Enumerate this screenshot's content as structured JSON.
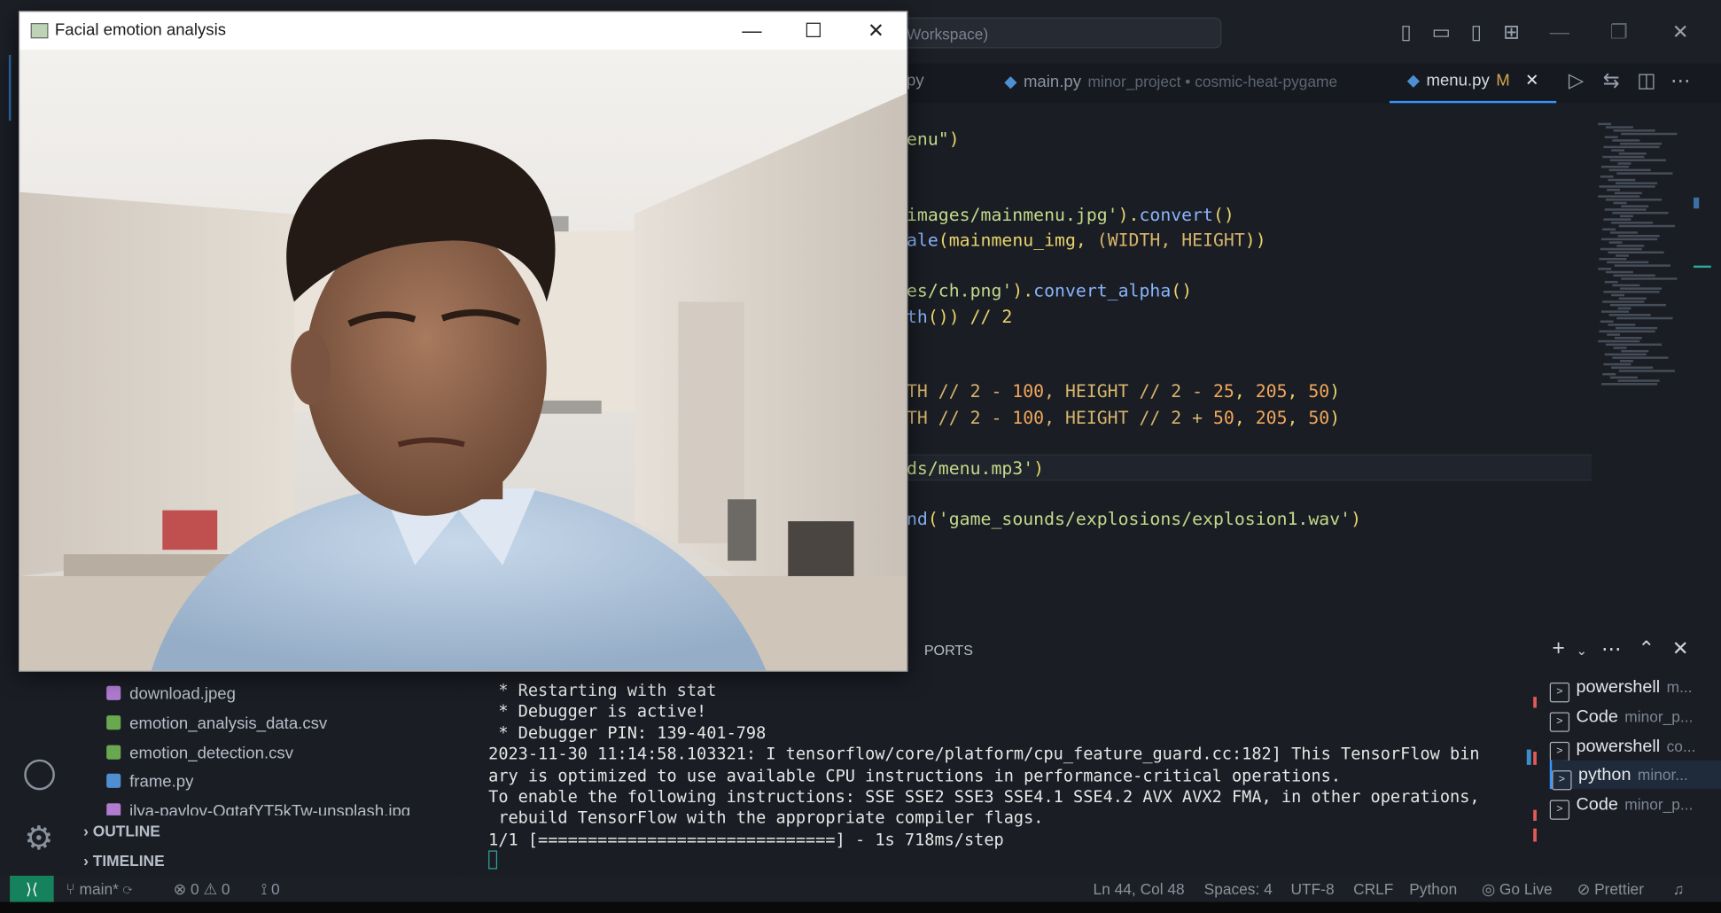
{
  "vscode": {
    "search_text": "Workspace)",
    "tabs": [
      {
        "label": "py",
        "desc": ""
      },
      {
        "label": "main.py",
        "desc": "minor_project • cosmic-heat-pygame"
      },
      {
        "label": "menu.py",
        "desc": "M"
      }
    ],
    "code_lines": [
      {
        "parts": [
          [
            "enu\"",
            "str"
          ],
          [
            ")",
            "par"
          ]
        ]
      },
      {
        "parts": [
          [
            "images/mainmenu.jpg'",
            "str"
          ],
          [
            ").",
            "par"
          ],
          [
            "convert",
            "fn"
          ],
          [
            "()",
            "par"
          ]
        ]
      },
      {
        "parts": [
          [
            "ale",
            "fn"
          ],
          [
            "(mainmenu_img, ",
            "par"
          ],
          [
            "(WIDTH, HEIGHT",
            "kw"
          ],
          [
            "))",
            "par"
          ]
        ]
      },
      {
        "parts": [
          [
            "es/ch.png'",
            "str"
          ],
          [
            ").",
            "par"
          ],
          [
            "convert_alpha",
            "fn"
          ],
          [
            "()",
            "par"
          ]
        ]
      },
      {
        "parts": [
          [
            "th",
            "fn"
          ],
          [
            "()) // 2",
            "par"
          ]
        ]
      },
      {
        "parts": [
          [
            "TH // 2 - ",
            "kw"
          ],
          [
            "100",
            "num"
          ],
          [
            ", HEIGHT // 2 - ",
            "kw"
          ],
          [
            "25",
            "num"
          ],
          [
            ", ",
            "par"
          ],
          [
            "205",
            "num"
          ],
          [
            ", ",
            "par"
          ],
          [
            "50",
            "num"
          ],
          [
            ")",
            "par"
          ]
        ]
      },
      {
        "parts": [
          [
            "TH // 2 - ",
            "kw"
          ],
          [
            "100",
            "num"
          ],
          [
            ", HEIGHT // 2 + ",
            "kw"
          ],
          [
            "50",
            "num"
          ],
          [
            ", ",
            "par"
          ],
          [
            "205",
            "num"
          ],
          [
            ", ",
            "par"
          ],
          [
            "50",
            "num"
          ],
          [
            ")",
            "par"
          ]
        ]
      },
      {
        "parts": [
          [
            "ds/menu.mp3'",
            "str"
          ],
          [
            ")",
            "par"
          ]
        ]
      },
      {
        "parts": [
          [
            "nd",
            "fn"
          ],
          [
            "(",
            "par"
          ],
          [
            "'game_sounds/explosions/explosion1.wav'",
            "str"
          ],
          [
            ")",
            "par"
          ]
        ]
      }
    ],
    "files": [
      {
        "name": "download.jpeg",
        "type": "image"
      },
      {
        "name": "emotion_analysis_data.csv",
        "type": "csv"
      },
      {
        "name": "emotion_detection.csv",
        "type": "csv"
      },
      {
        "name": "frame.py",
        "type": "python"
      },
      {
        "name": "ilya-pavlov-OqtafYT5kTw-unsplash.jpg",
        "type": "image"
      }
    ],
    "sections": {
      "outline": "OUTLINE",
      "timeline": "TIMELINE"
    },
    "panel": {
      "ports_label": "PORTS"
    },
    "terminal_lines": [
      " * Restarting with stat",
      " * Debugger is active!",
      " * Debugger PIN: 139-401-798",
      "2023-11-30 11:14:58.103321: I tensorflow/core/platform/cpu_feature_guard.cc:182] This TensorFlow bin",
      "ary is optimized to use available CPU instructions in performance-critical operations.",
      "To enable the following instructions: SSE SSE2 SSE3 SSE4.1 SSE4.2 AVX AVX2 FMA, in other operations,",
      " rebuild TensorFlow with the appropriate compiler flags.",
      "1/1 [==============================] - 1s 718ms/step"
    ],
    "terminals": [
      {
        "name": "powershell",
        "sub": "m..."
      },
      {
        "name": "Code",
        "sub": "minor_p..."
      },
      {
        "name": "powershell",
        "sub": "co..."
      },
      {
        "name": "python",
        "sub": "minor..."
      },
      {
        "name": "Code",
        "sub": "minor_p..."
      }
    ],
    "status": {
      "branch": "main*",
      "errors": "0",
      "warnings": "0",
      "ports": "0",
      "position": "Ln 44, Col 48",
      "spaces": "Spaces: 4",
      "encoding": "UTF-8",
      "eol": "CRLF",
      "language": "Python",
      "golive": "Go Live",
      "prettier": "Prettier"
    }
  },
  "camera_window": {
    "title": "Facial emotion analysis"
  },
  "colors": {
    "accent": "#3794ff",
    "remote": "#16825d"
  }
}
